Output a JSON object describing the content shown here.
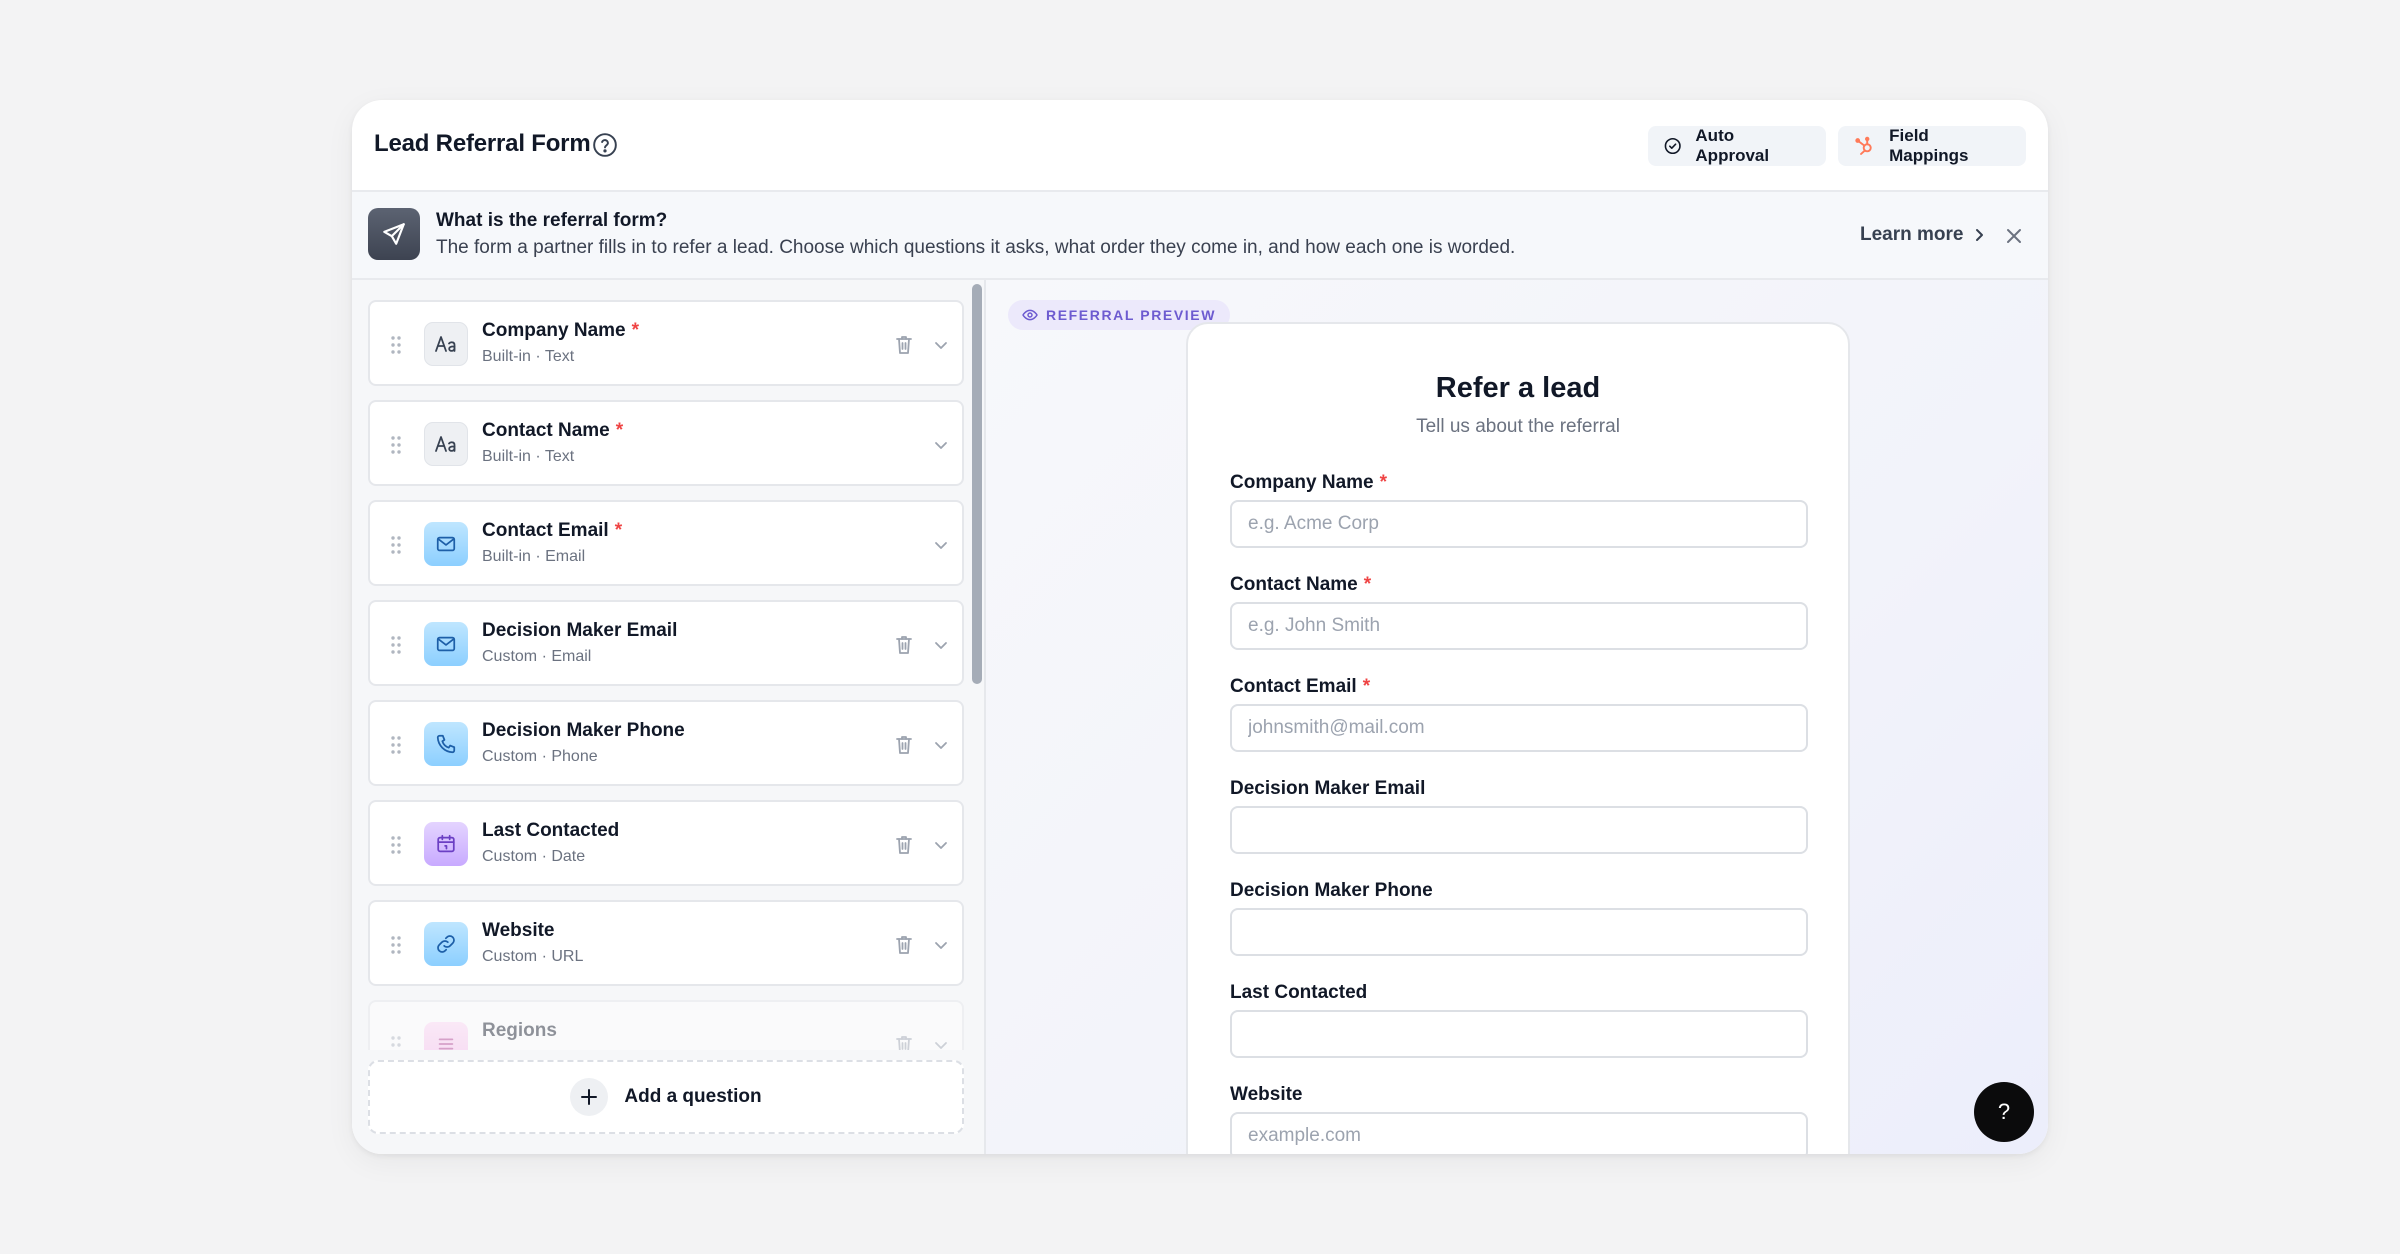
{
  "header": {
    "title": "Lead Referral Form",
    "auto_approval_label": "Auto Approval",
    "field_mappings_label": "Field Mappings"
  },
  "banner": {
    "title": "What is the referral form?",
    "text": "The form a partner fills in to refer a lead. Choose which questions it asks, what order they come in, and how each one is worded.",
    "learn_more": "Learn more"
  },
  "questions": [
    {
      "label": "Company Name",
      "required": "*",
      "sub": "Built-in · Text",
      "icon": "text-type-icon"
    },
    {
      "label": "Contact Name",
      "required": "*",
      "sub": "Built-in · Text",
      "icon": "text-type-icon"
    },
    {
      "label": "Contact Email",
      "required": "*",
      "sub": "Built-in · Email",
      "icon": "mail-icon"
    },
    {
      "label": "Decision Maker Email",
      "sub": "Custom · Email",
      "icon": "mail-icon"
    },
    {
      "label": "Decision Maker Phone",
      "sub": "Custom · Phone",
      "icon": "phone-icon"
    },
    {
      "label": "Last Contacted",
      "sub": "Custom · Date",
      "icon": "calendar-icon"
    },
    {
      "label": "Website",
      "sub": "Custom · URL",
      "icon": "link-icon"
    },
    {
      "label": "Regions",
      "sub": "",
      "icon": "list-icon"
    }
  ],
  "add_question_label": "Add a question",
  "preview": {
    "badge": "REFERRAL PREVIEW",
    "title": "Refer a lead",
    "subtitle": "Tell us about the referral",
    "fields": [
      {
        "label": "Company Name",
        "required": "*",
        "placeholder": "e.g. Acme Corp"
      },
      {
        "label": "Contact Name",
        "required": "*",
        "placeholder": "e.g. John Smith"
      },
      {
        "label": "Contact Email",
        "required": "*",
        "placeholder": "johnsmith@mail.com"
      },
      {
        "label": "Decision Maker Email",
        "placeholder": ""
      },
      {
        "label": "Decision Maker Phone",
        "placeholder": ""
      },
      {
        "label": "Last Contacted",
        "placeholder": ""
      },
      {
        "label": "Website",
        "placeholder": "example.com"
      }
    ]
  },
  "fab_label": "?",
  "colors": {
    "accent": "#6d5bd0",
    "required": "#ef4444",
    "hubspot": "#ff7a59"
  }
}
